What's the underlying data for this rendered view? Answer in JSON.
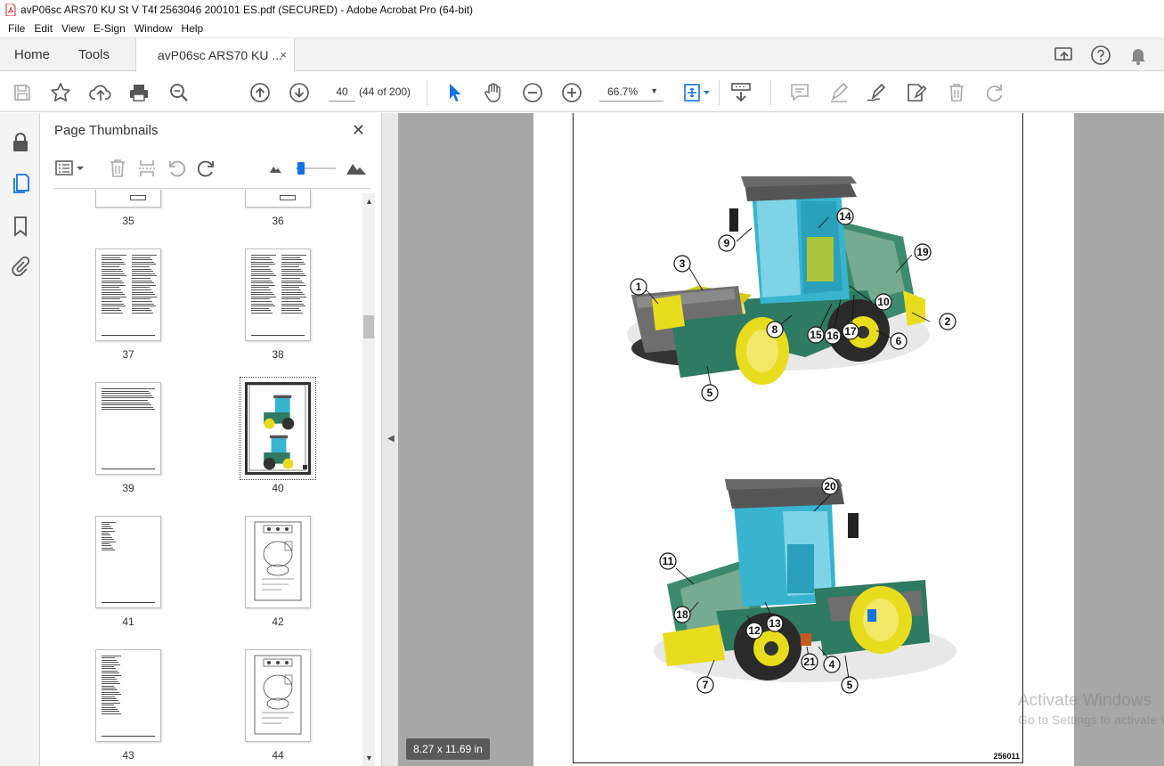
{
  "window": {
    "title": "avP06sc ARS70 KU St V T4f 2563046 200101 ES.pdf (SECURED) - Adobe Acrobat Pro (64-bit)"
  },
  "menu": [
    "File",
    "Edit",
    "View",
    "E-Sign",
    "Window",
    "Help"
  ],
  "tabs": {
    "home": "Home",
    "tools": "Tools",
    "document": "avP06sc ARS70 KU ...",
    "close": "×"
  },
  "toolbar": {
    "page_number": "40",
    "page_count": "(44 of 200)",
    "zoom": "66.7%"
  },
  "panel": {
    "title": "Page Thumbnails",
    "close": "✕",
    "thumbnails": [
      {
        "label": "35"
      },
      {
        "label": "36"
      },
      {
        "label": "37"
      },
      {
        "label": "38"
      },
      {
        "label": "39"
      },
      {
        "label": "40",
        "selected": true
      },
      {
        "label": "41"
      },
      {
        "label": "42"
      },
      {
        "label": "43"
      },
      {
        "label": "44"
      }
    ]
  },
  "document": {
    "page_size": "8.27 x 11.69 in",
    "figure_id": "256011",
    "callouts_top": [
      "1",
      "2",
      "3",
      "5",
      "6",
      "8",
      "9",
      "10",
      "14",
      "15",
      "16",
      "17",
      "19"
    ],
    "callouts_bottom": [
      "4",
      "5",
      "7",
      "11",
      "12",
      "13",
      "18",
      "20",
      "21"
    ]
  },
  "watermark": {
    "line1": "Activate Windows",
    "line2": "Go to Settings to activate Windows."
  },
  "colors": {
    "acrobat_red": "#d4252b",
    "select_blue": "#1473e6",
    "machine_yellow": "#e8dc1e",
    "machine_green": "#2f7a62",
    "cab_glass": "#38b4cf"
  }
}
